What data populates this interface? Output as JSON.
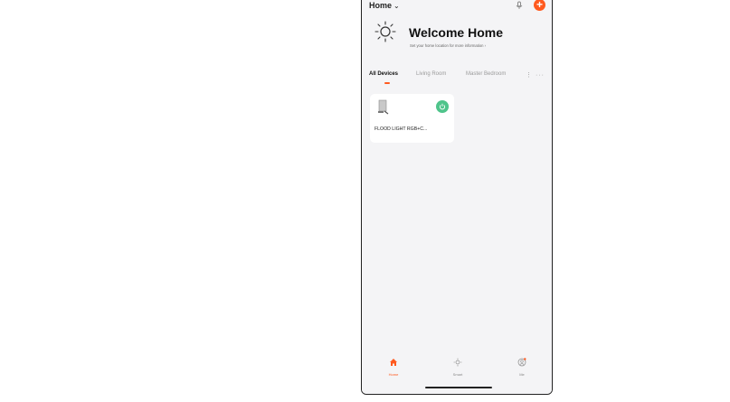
{
  "header": {
    "title": "Home",
    "chevron": "⌄"
  },
  "welcome": {
    "title": "Welcome Home",
    "subtitle": "Set your home location for more information  ›"
  },
  "tabs": [
    {
      "label": "All Devices",
      "active": true
    },
    {
      "label": "Living Room",
      "active": false
    },
    {
      "label": "Master Bedroom",
      "active": false
    }
  ],
  "tabs_more": "⋮ ···",
  "device": {
    "name": "FLOOD LIGHT RGB+C...",
    "status": "on"
  },
  "nav": [
    {
      "label": "Home",
      "icon": "home-icon",
      "active": true
    },
    {
      "label": "Smart",
      "icon": "sun-icon",
      "active": false
    },
    {
      "label": "Me",
      "icon": "profile-icon",
      "active": false
    }
  ],
  "colors": {
    "accent": "#ff5a1f",
    "power_on": "#4fc48b",
    "background": "#f4f4f6"
  }
}
